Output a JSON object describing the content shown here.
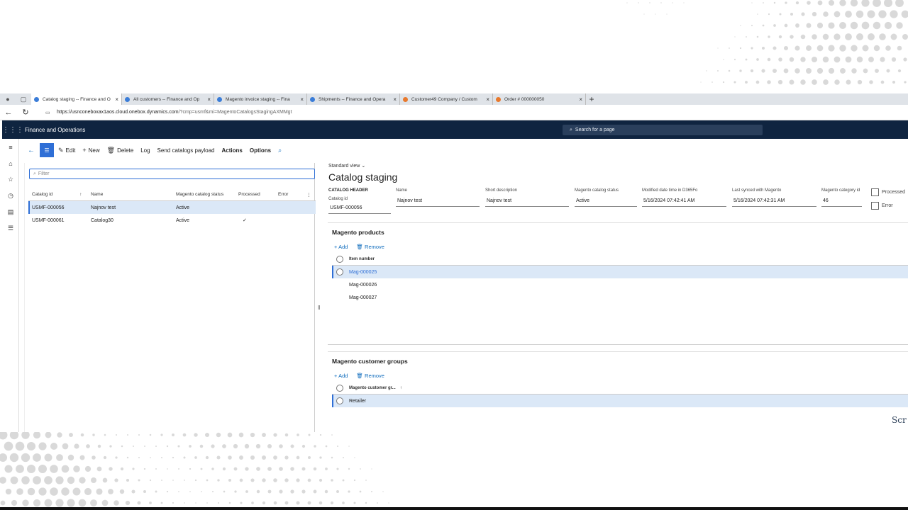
{
  "browser": {
    "tabs": [
      {
        "label": "Catalog staging -- Finance and O",
        "color": "#3b7dd8",
        "active": true
      },
      {
        "label": "All customers -- Finance and Op",
        "color": "#3b7dd8",
        "active": false
      },
      {
        "label": "Magento invoice staging -- Fina",
        "color": "#3b7dd8",
        "active": false
      },
      {
        "label": "Shipments -- Finance and Opera",
        "color": "#3b7dd8",
        "active": false
      },
      {
        "label": "Customer49 Company / Custom",
        "color": "#e8792d",
        "active": false
      },
      {
        "label": "Order # 000000050",
        "color": "#e8792d",
        "active": false
      }
    ],
    "close_glyph": "×",
    "new_tab_glyph": "+",
    "url_host": "https://usnconeboxax1aos.cloud.onebox.dynamics.com",
    "url_path": "/?cmp=usmf&mi=MagentoCatalogsStagingAXMMgt"
  },
  "app": {
    "name": "Finance and Operations",
    "search_placeholder": "Search for a page"
  },
  "actions": {
    "edit": "Edit",
    "new": "New",
    "delete": "Delete",
    "log": "Log",
    "send": "Send catalogs payload",
    "actions": "Actions",
    "options": "Options"
  },
  "list": {
    "filter_placeholder": "Filter",
    "columns": [
      "Catalog id",
      "Name",
      "Magento catalog status",
      "Processed",
      "Error"
    ],
    "sort_glyph": "↑",
    "more_glyph": "⋮",
    "rows": [
      {
        "id": "USMF-000056",
        "name": "Najnov test",
        "status": "Active",
        "processed": "",
        "error": ""
      },
      {
        "id": "USMF-000061",
        "name": "Catalog30",
        "status": "Active",
        "processed": "✓",
        "error": ""
      }
    ]
  },
  "detail": {
    "view": "Standard view",
    "title": "Catalog staging",
    "header_label": "CATALOG HEADER",
    "catalog_id_label": "Catalog id",
    "catalog_id": "USMF-000056",
    "name_label": "Name",
    "name": "Najnov test",
    "short_desc_label": "Short description",
    "short_desc": "Najnov test",
    "status_label": "Magento catalog status",
    "status": "Active",
    "modified_label": "Modified date time in D365Fo",
    "modified": "5/16/2024 07:42:41 AM",
    "synced_label": "Last synced with Magento",
    "synced": "5/16/2024 07:42:31 AM",
    "category_label": "Magento category id",
    "category": "46",
    "processed_label": "Processed",
    "error_label": "Error"
  },
  "products": {
    "title": "Magento products",
    "add": "Add",
    "remove": "Remove",
    "column": "Item number",
    "items": [
      "Mag-000025",
      "Mag-000026",
      "Mag-000027"
    ]
  },
  "groups": {
    "title": "Magento customer groups",
    "add": "Add",
    "remove": "Remove",
    "column": "Magento customer gr...",
    "sort_glyph": "↑",
    "items": [
      "Retailer"
    ]
  },
  "overlay_text": "Scr"
}
